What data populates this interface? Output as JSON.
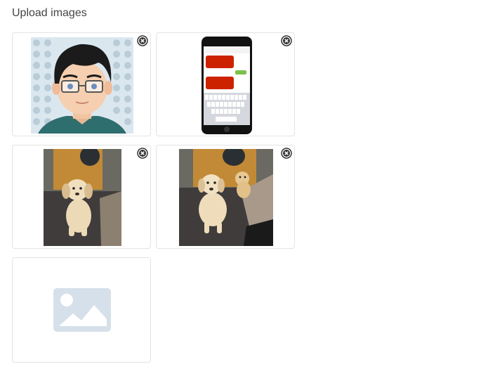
{
  "header": {
    "title": "Upload images"
  },
  "images": [
    {
      "name": "avatar-cartoon-man",
      "remove_icon": "close-circle-icon"
    },
    {
      "name": "phone-messages-screenshot",
      "remove_icon": "close-circle-icon"
    },
    {
      "name": "puppy-photo",
      "remove_icon": "close-circle-icon"
    },
    {
      "name": "dogs-photo",
      "remove_icon": "close-circle-icon"
    }
  ],
  "add_slot": {
    "icon": "image-placeholder-icon"
  },
  "colors": {
    "placeholder": "#d6e0ea",
    "border": "#e3e3e3",
    "icon_dark": "#333333",
    "phone_bubble_red": "#cc2200",
    "phone_bubble_green": "#7cc04a"
  }
}
